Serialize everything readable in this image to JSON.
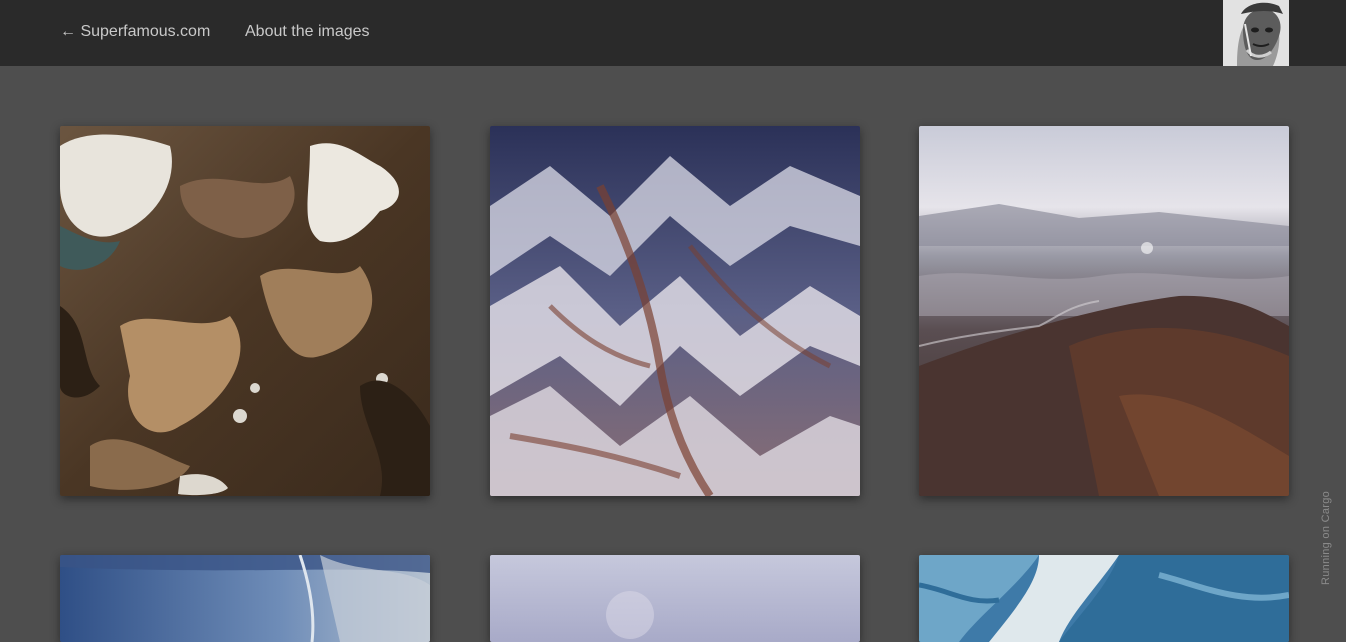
{
  "nav": {
    "back_label": "← Superfamous.com",
    "about_label": "About the images"
  },
  "avatar": {
    "icon": "portrait-icon"
  },
  "gallery": {
    "images": [
      {
        "subject": "aerial-lakes-brown-terrain"
      },
      {
        "subject": "aerial-snowy-mountain-ridges"
      },
      {
        "subject": "aerial-hazy-mountain-valley"
      },
      {
        "subject": "aerial-blue-plain"
      },
      {
        "subject": "aerial-pale-sky"
      },
      {
        "subject": "aerial-blue-river-delta"
      }
    ]
  },
  "footer": {
    "cargo_label": "Running on Cargo"
  },
  "colors": {
    "topbar": "#2a2a2a",
    "background": "#4e4e4e",
    "nav_text": "#c9c9c9"
  }
}
